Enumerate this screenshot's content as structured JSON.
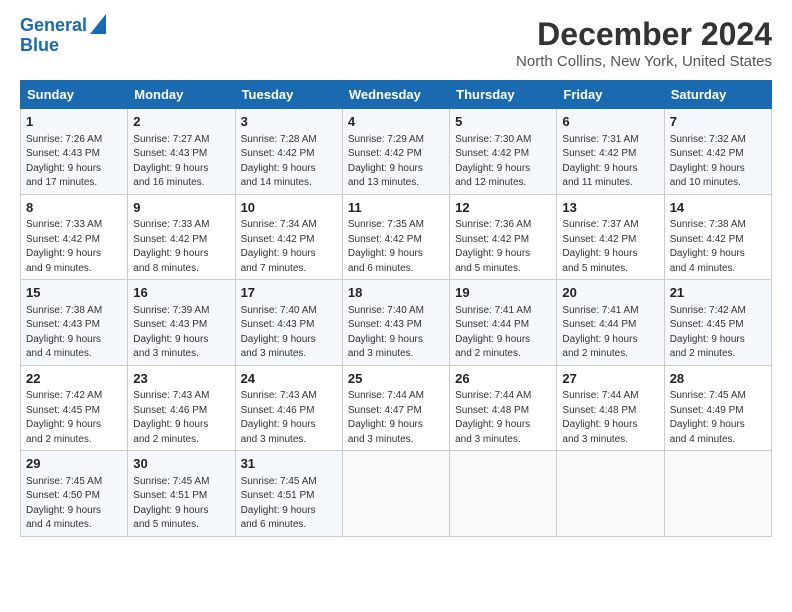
{
  "brand": {
    "line1": "General",
    "line2": "Blue"
  },
  "header": {
    "month": "December 2024",
    "location": "North Collins, New York, United States"
  },
  "columns": [
    "Sunday",
    "Monday",
    "Tuesday",
    "Wednesday",
    "Thursday",
    "Friday",
    "Saturday"
  ],
  "weeks": [
    [
      {
        "day": "1",
        "info": "Sunrise: 7:26 AM\nSunset: 4:43 PM\nDaylight: 9 hours\nand 17 minutes."
      },
      {
        "day": "2",
        "info": "Sunrise: 7:27 AM\nSunset: 4:43 PM\nDaylight: 9 hours\nand 16 minutes."
      },
      {
        "day": "3",
        "info": "Sunrise: 7:28 AM\nSunset: 4:42 PM\nDaylight: 9 hours\nand 14 minutes."
      },
      {
        "day": "4",
        "info": "Sunrise: 7:29 AM\nSunset: 4:42 PM\nDaylight: 9 hours\nand 13 minutes."
      },
      {
        "day": "5",
        "info": "Sunrise: 7:30 AM\nSunset: 4:42 PM\nDaylight: 9 hours\nand 12 minutes."
      },
      {
        "day": "6",
        "info": "Sunrise: 7:31 AM\nSunset: 4:42 PM\nDaylight: 9 hours\nand 11 minutes."
      },
      {
        "day": "7",
        "info": "Sunrise: 7:32 AM\nSunset: 4:42 PM\nDaylight: 9 hours\nand 10 minutes."
      }
    ],
    [
      {
        "day": "8",
        "info": "Sunrise: 7:33 AM\nSunset: 4:42 PM\nDaylight: 9 hours\nand 9 minutes."
      },
      {
        "day": "9",
        "info": "Sunrise: 7:33 AM\nSunset: 4:42 PM\nDaylight: 9 hours\nand 8 minutes."
      },
      {
        "day": "10",
        "info": "Sunrise: 7:34 AM\nSunset: 4:42 PM\nDaylight: 9 hours\nand 7 minutes."
      },
      {
        "day": "11",
        "info": "Sunrise: 7:35 AM\nSunset: 4:42 PM\nDaylight: 9 hours\nand 6 minutes."
      },
      {
        "day": "12",
        "info": "Sunrise: 7:36 AM\nSunset: 4:42 PM\nDaylight: 9 hours\nand 5 minutes."
      },
      {
        "day": "13",
        "info": "Sunrise: 7:37 AM\nSunset: 4:42 PM\nDaylight: 9 hours\nand 5 minutes."
      },
      {
        "day": "14",
        "info": "Sunrise: 7:38 AM\nSunset: 4:42 PM\nDaylight: 9 hours\nand 4 minutes."
      }
    ],
    [
      {
        "day": "15",
        "info": "Sunrise: 7:38 AM\nSunset: 4:43 PM\nDaylight: 9 hours\nand 4 minutes."
      },
      {
        "day": "16",
        "info": "Sunrise: 7:39 AM\nSunset: 4:43 PM\nDaylight: 9 hours\nand 3 minutes."
      },
      {
        "day": "17",
        "info": "Sunrise: 7:40 AM\nSunset: 4:43 PM\nDaylight: 9 hours\nand 3 minutes."
      },
      {
        "day": "18",
        "info": "Sunrise: 7:40 AM\nSunset: 4:43 PM\nDaylight: 9 hours\nand 3 minutes."
      },
      {
        "day": "19",
        "info": "Sunrise: 7:41 AM\nSunset: 4:44 PM\nDaylight: 9 hours\nand 2 minutes."
      },
      {
        "day": "20",
        "info": "Sunrise: 7:41 AM\nSunset: 4:44 PM\nDaylight: 9 hours\nand 2 minutes."
      },
      {
        "day": "21",
        "info": "Sunrise: 7:42 AM\nSunset: 4:45 PM\nDaylight: 9 hours\nand 2 minutes."
      }
    ],
    [
      {
        "day": "22",
        "info": "Sunrise: 7:42 AM\nSunset: 4:45 PM\nDaylight: 9 hours\nand 2 minutes."
      },
      {
        "day": "23",
        "info": "Sunrise: 7:43 AM\nSunset: 4:46 PM\nDaylight: 9 hours\nand 2 minutes."
      },
      {
        "day": "24",
        "info": "Sunrise: 7:43 AM\nSunset: 4:46 PM\nDaylight: 9 hours\nand 3 minutes."
      },
      {
        "day": "25",
        "info": "Sunrise: 7:44 AM\nSunset: 4:47 PM\nDaylight: 9 hours\nand 3 minutes."
      },
      {
        "day": "26",
        "info": "Sunrise: 7:44 AM\nSunset: 4:48 PM\nDaylight: 9 hours\nand 3 minutes."
      },
      {
        "day": "27",
        "info": "Sunrise: 7:44 AM\nSunset: 4:48 PM\nDaylight: 9 hours\nand 3 minutes."
      },
      {
        "day": "28",
        "info": "Sunrise: 7:45 AM\nSunset: 4:49 PM\nDaylight: 9 hours\nand 4 minutes."
      }
    ],
    [
      {
        "day": "29",
        "info": "Sunrise: 7:45 AM\nSunset: 4:50 PM\nDaylight: 9 hours\nand 4 minutes."
      },
      {
        "day": "30",
        "info": "Sunrise: 7:45 AM\nSunset: 4:51 PM\nDaylight: 9 hours\nand 5 minutes."
      },
      {
        "day": "31",
        "info": "Sunrise: 7:45 AM\nSunset: 4:51 PM\nDaylight: 9 hours\nand 6 minutes."
      },
      null,
      null,
      null,
      null
    ]
  ]
}
